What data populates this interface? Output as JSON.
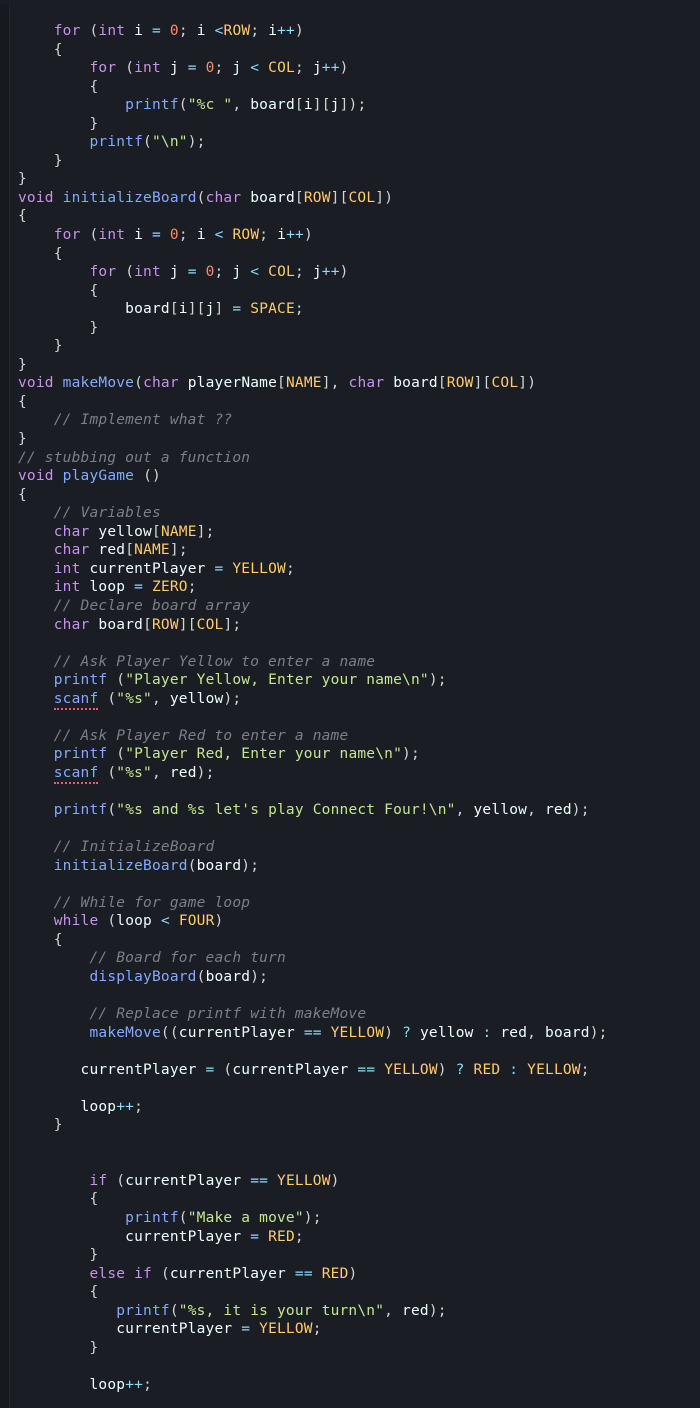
{
  "language": "c",
  "colors": {
    "background": "#1a1d23",
    "keyword": "#c792ea",
    "function": "#82aaff",
    "number": "#f78c6c",
    "constant": "#ffcb6b",
    "string": "#c3e88d",
    "comment": "#7a7f8a",
    "operator": "#89ddff"
  },
  "errors": [
    "scanf",
    "scanf"
  ],
  "constants_referenced": [
    "ROW",
    "COL",
    "SPACE",
    "NAME",
    "YELLOW",
    "ZERO",
    "FOUR",
    "RED"
  ],
  "functions_referenced": [
    "printf",
    "initializeBoard",
    "makeMove",
    "playGame",
    "scanf",
    "displayBoard"
  ],
  "code_lines": [
    "    for (int i = 0; i <ROW; i++)",
    "    {",
    "        for (int j = 0; j < COL; j++)",
    "        {",
    "            printf(\"%c \", board[i][j]);",
    "        }",
    "        printf(\"\\n\");",
    "    }",
    "}",
    "void initializeBoard(char board[ROW][COL])",
    "{",
    "    for (int i = 0; i < ROW; i++)",
    "    {",
    "        for (int j = 0; j < COL; j++)",
    "        {",
    "            board[i][j] = SPACE;",
    "        }",
    "    }",
    "}",
    "void makeMove(char playerName[NAME], char board[ROW][COL])",
    "{",
    "    // Implement what ??",
    "}",
    "// stubbing out a function",
    "void playGame ()",
    "{",
    "    // Variables",
    "    char yellow[NAME];",
    "    char red[NAME];",
    "    int currentPlayer = YELLOW;",
    "    int loop = ZERO;",
    "    // Declare board array",
    "    char board[ROW][COL];",
    "",
    "    // Ask Player Yellow to enter a name",
    "    printf (\"Player Yellow, Enter your name\\n\");",
    "    scanf (\"%s\", yellow);",
    "",
    "    // Ask Player Red to enter a name",
    "    printf (\"Player Red, Enter your name\\n\");",
    "    scanf (\"%s\", red);",
    "",
    "    printf(\"%s and %s let's play Connect Four!\\n\", yellow, red);",
    "",
    "    // InitializeBoard",
    "    initializeBoard(board);",
    "",
    "    // While for game loop",
    "    while (loop < FOUR)",
    "    {",
    "        // Board for each turn",
    "        displayBoard(board);",
    "",
    "        // Replace printf with makeMove",
    "        makeMove((currentPlayer == YELLOW) ? yellow : red, board);",
    "",
    "       currentPlayer = (currentPlayer == YELLOW) ? RED : YELLOW;",
    "",
    "       loop++;",
    "    }",
    "",
    "",
    "        if (currentPlayer == YELLOW)",
    "        {",
    "            printf(\"Make a move\");",
    "            currentPlayer = RED;",
    "        }",
    "        else if (currentPlayer == RED)",
    "        {",
    "           printf(\"%s, it is your turn\\n\", red);",
    "           currentPlayer = YELLOW;",
    "        }",
    "",
    "        loop++;"
  ]
}
